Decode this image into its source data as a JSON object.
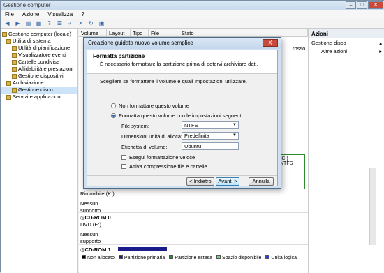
{
  "window": {
    "title": "Gestione computer"
  },
  "menu": [
    "File",
    "Azione",
    "Visualizza",
    "?"
  ],
  "tree": [
    {
      "label": "Gestione computer (locale)",
      "indent": 0
    },
    {
      "label": "Utilità di sistema",
      "indent": 1
    },
    {
      "label": "Utilità di pianificazione",
      "indent": 2
    },
    {
      "label": "Visualizzatore eventi",
      "indent": 2
    },
    {
      "label": "Cartelle condivise",
      "indent": 2
    },
    {
      "label": "Affidabilità e prestazioni",
      "indent": 2
    },
    {
      "label": "Gestione dispositivi",
      "indent": 2
    },
    {
      "label": "Archiviazione",
      "indent": 1
    },
    {
      "label": "Gestione disco",
      "indent": 2,
      "selected": true
    },
    {
      "label": "Servizi e applicazioni",
      "indent": 1
    }
  ],
  "columns": [
    "Volume",
    "Layout",
    "Tipo",
    "File Sistema",
    "Stato"
  ],
  "disks": {
    "row_partial_text": "rosso",
    "removable_label": "Rimovibile (K:)",
    "removable_media": "Nessun supporto",
    "cdrom0_name": "CD-ROM 0",
    "cdrom0_drive": "DVD (E:)",
    "cdrom0_media": "Nessun supporto",
    "cdrom1_name": "CD-ROM 1",
    "part_label_a": "(C:)",
    "part_label_b": "NTFS"
  },
  "legend": [
    {
      "label": "Non allocato",
      "color": "#000000"
    },
    {
      "label": "Partizione primaria",
      "color": "#1b1b8a"
    },
    {
      "label": "Partizione estesa",
      "color": "#2e8b2e"
    },
    {
      "label": "Spazio disponibile",
      "color": "#7ed37e"
    },
    {
      "label": "Unità logica",
      "color": "#3040c8"
    }
  ],
  "actions": {
    "header": "Azioni",
    "primary": "Gestione disco",
    "secondary": "Altre azioni"
  },
  "dialog": {
    "title": "Creazione guidata nuovo volume semplice",
    "close": "X",
    "heading": "Formatta partizione",
    "subheading": "È necessario formattare la partizione prima di potervi archiviare dati.",
    "intro": "Scegliere se formattare il volume e quali impostazioni utilizzare.",
    "radio_no": "Non formattare questo volume",
    "radio_yes": "Formatta questo volume con le impostazioni seguenti:",
    "fs_label": "File system:",
    "fs_value": "NTFS",
    "alloc_label": "Dimensioni unità di allocazione:",
    "alloc_value": "Predefinita",
    "vol_label": "Etichetta di volume:",
    "vol_value": "Ubuntu",
    "quick_format": "Esegui formattazione veloce",
    "compression": "Attiva compressione file e cartelle",
    "back": "< Indietro",
    "next": "Avanti >",
    "cancel": "Annulla"
  }
}
